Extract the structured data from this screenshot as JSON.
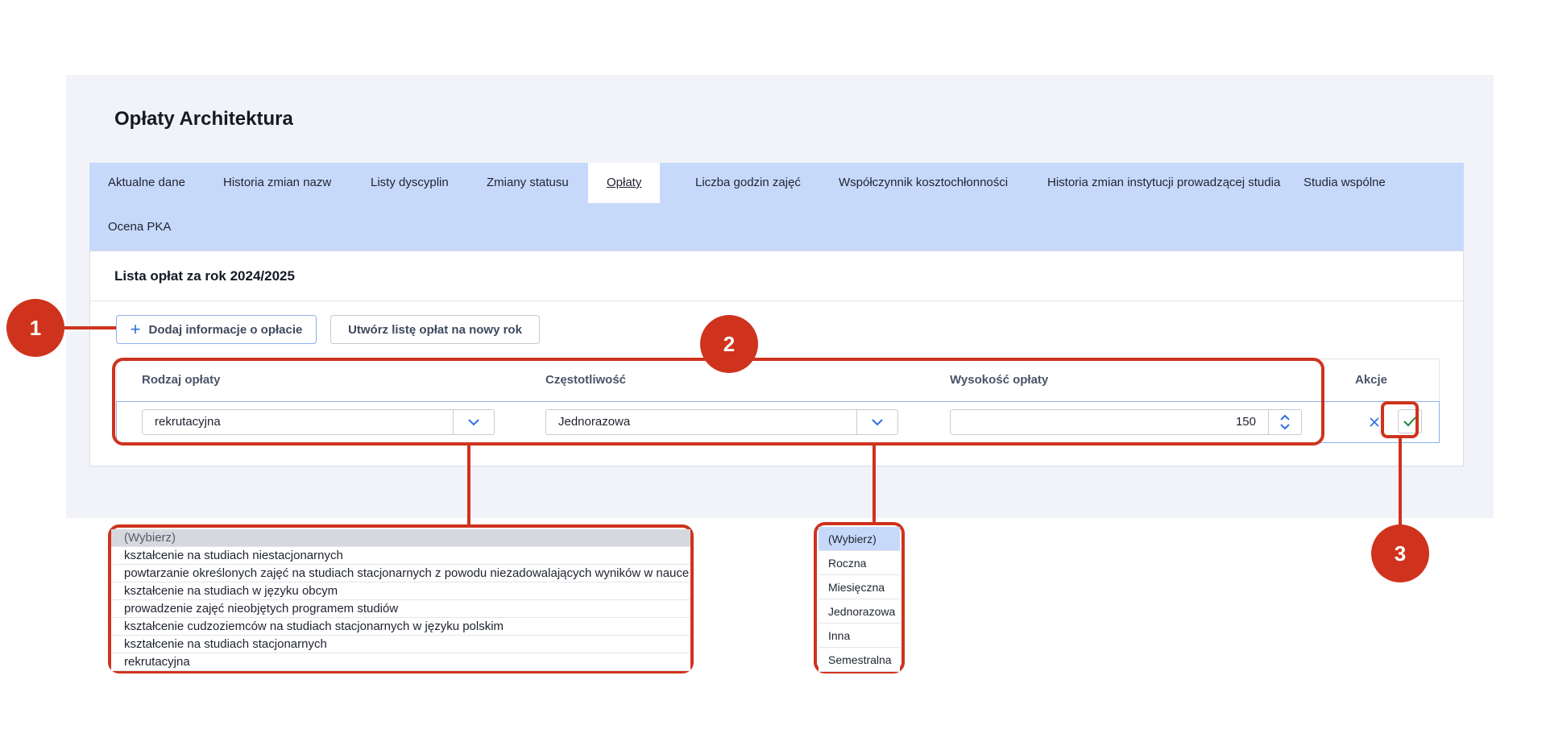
{
  "page": {
    "title": "Opłaty Architektura"
  },
  "tabs": [
    {
      "label": "Aktualne dane"
    },
    {
      "label": "Historia zmian nazw"
    },
    {
      "label": "Listy dyscyplin"
    },
    {
      "label": "Zmiany statusu"
    },
    {
      "label": "Opłaty",
      "active": true
    },
    {
      "label": "Liczba godzin zajęć"
    },
    {
      "label": "Współczynnik kosztochłonności"
    },
    {
      "label": "Historia zmian instytucji prowadzącej studia"
    },
    {
      "label": "Studia wspólne"
    },
    {
      "label": "Ocena PKA"
    }
  ],
  "card": {
    "title": "Lista opłat za rok 2024/2025",
    "add_button": "Dodaj informacje o opłacie",
    "new_list_button": "Utwórz listę opłat na nowy rok"
  },
  "table": {
    "headers": [
      "Rodzaj opłaty",
      "Częstotliwość",
      "Wysokość opłaty",
      "Akcje"
    ],
    "row": {
      "rodzaj": "rekrutacyjna",
      "czestotliwosc": "Jednorazowa",
      "wysokosc": "150"
    }
  },
  "dropdown_rodzaj": [
    "(Wybierz)",
    "kształcenie na studiach niestacjonarnych",
    "powtarzanie określonych zajęć na studiach stacjonarnych z powodu niezadowalających wyników w nauce",
    "kształcenie na studiach w języku obcym",
    "prowadzenie zajęć nieobjętych programem studiów",
    "kształcenie cudzoziemców na studiach stacjonarnych w języku polskim",
    "kształcenie na studiach stacjonarnych",
    "rekrutacyjna"
  ],
  "dropdown_czestotliwosc": [
    "(Wybierz)",
    "Roczna",
    "Miesięczna",
    "Jednorazowa",
    "Inna",
    "Semestralna"
  ],
  "callouts": [
    "1",
    "2",
    "3"
  ],
  "icons": {
    "plus": "plus-icon",
    "chevron": "chevron-down-icon",
    "spinner": "spinner-icon",
    "cancel": "close-icon",
    "confirm": "check-icon"
  },
  "colors": {
    "accent": "#2f6fe0",
    "tab_bar": "#c7d9fb",
    "callout": "#cf331d",
    "confirm": "#1e8a3c"
  }
}
